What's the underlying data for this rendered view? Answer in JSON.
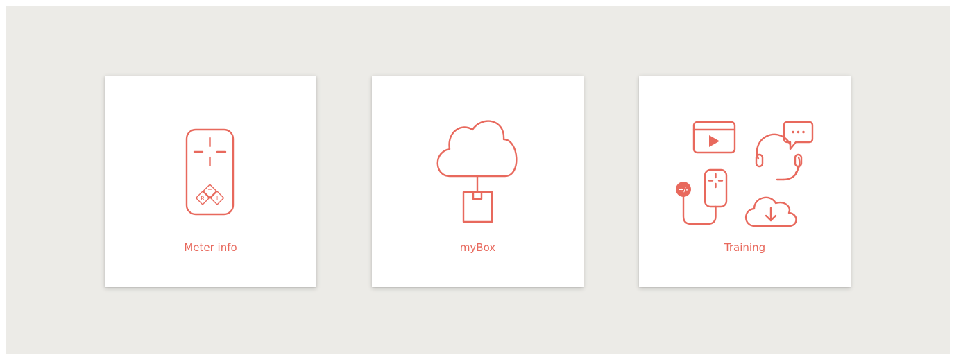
{
  "accent_color": "#e8695d",
  "cards": [
    {
      "label": "Meter info",
      "icon": "meter-device-icon"
    },
    {
      "label": "myBox",
      "icon": "cloud-box-icon"
    },
    {
      "label": "Training",
      "icon": "training-icon"
    }
  ],
  "meter_logo": {
    "letters": [
      "R",
      "T",
      "I"
    ]
  },
  "training_badge": "+/-"
}
